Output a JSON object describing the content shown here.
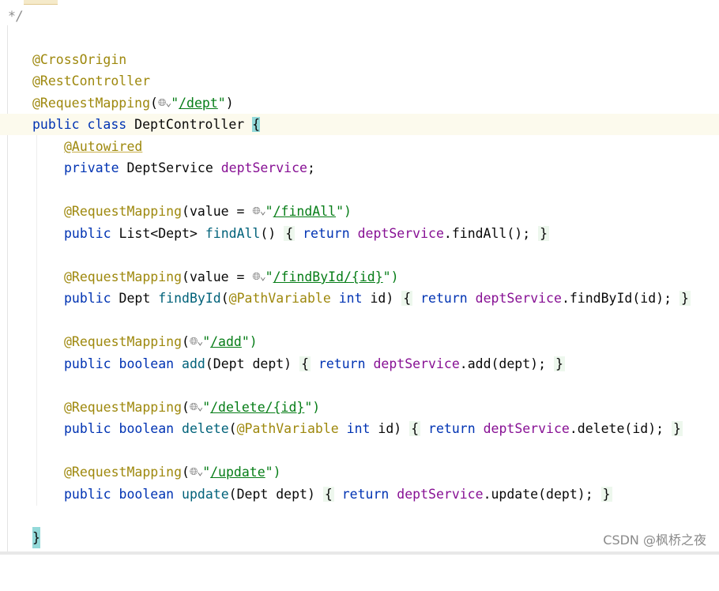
{
  "editor": {
    "comment_end": "*/",
    "lines": {
      "l_cross": "@CrossOrigin",
      "l_rest": "@RestController",
      "l_reqmap_ann": "@RequestMapping",
      "l_reqmap_open": "(",
      "l_reqmap_q1": "\"",
      "l_reqmap_url": "/dept",
      "l_reqmap_q2": "\"",
      "l_reqmap_close": ")",
      "l_class_public": "public",
      "l_class_kw": "class",
      "l_class_name": "DeptController",
      "l_class_brace": "{",
      "l_autowired": "@Autowired",
      "l_field_private": "private",
      "l_field_type": "DeptService",
      "l_field_name": "deptService",
      "l_field_semi": ";",
      "m1_ann": "@RequestMapping",
      "m1_args": "(value = ",
      "m1_q1": "\"",
      "m1_url": "/findAll",
      "m1_q2": "\")",
      "m1_public": "public",
      "m1_type": "List<Dept>",
      "m1_name": "findAll",
      "m1_params": "()",
      "m1_open": "{",
      "m1_return": "return",
      "m1_field": "deptService",
      "m1_call": ".findAll();",
      "m1_close": "}",
      "m2_ann": "@RequestMapping",
      "m2_args": "(value = ",
      "m2_q1": "\"",
      "m2_url": "/findById/{id}",
      "m2_q2": "\")",
      "m2_public": "public",
      "m2_type": "Dept",
      "m2_name": "findById",
      "m2_paren": "(",
      "m2_pathvar": "@PathVariable",
      "m2_int": "int",
      "m2_param": "id)",
      "m2_open": "{",
      "m2_return": "return",
      "m2_field": "deptService",
      "m2_call": ".findById(id);",
      "m2_close": "}",
      "m3_ann": "@RequestMapping",
      "m3_open_paren": "(",
      "m3_q1": "\"",
      "m3_url": "/add",
      "m3_q2": "\")",
      "m3_public": "public",
      "m3_type": "boolean",
      "m3_name": "add",
      "m3_params": "(Dept dept)",
      "m3_open": "{",
      "m3_return": "return",
      "m3_field": "deptService",
      "m3_call": ".add(dept);",
      "m3_close": "}",
      "m4_ann": "@RequestMapping",
      "m4_open_paren": "(",
      "m4_q1": "\"",
      "m4_url": "/delete/{id}",
      "m4_q2": "\")",
      "m4_public": "public",
      "m4_type": "boolean",
      "m4_name": "delete",
      "m4_paren": "(",
      "m4_pathvar": "@PathVariable",
      "m4_int": "int",
      "m4_param": "id)",
      "m4_open": "{",
      "m4_return": "return",
      "m4_field": "deptService",
      "m4_call": ".delete(id);",
      "m4_close": "}",
      "m5_ann": "@RequestMapping",
      "m5_open_paren": "(",
      "m5_q1": "\"",
      "m5_url": "/update",
      "m5_q2": "\")",
      "m5_public": "public",
      "m5_type": "boolean",
      "m5_name": "update",
      "m5_params": "(Dept dept)",
      "m5_open": "{",
      "m5_return": "return",
      "m5_field": "deptService",
      "m5_call": ".update(dept);",
      "m5_close": "}",
      "l_class_end": "}"
    },
    "globe_glyph": "🌐︎⌄"
  },
  "watermark": "CSDN @枫桥之夜",
  "colors": {
    "keyword": "#0033b3",
    "annotation": "#9e880d",
    "string": "#067d17",
    "field": "#871094",
    "method": "#00627a",
    "brace_highlight": "#93d9d9",
    "current_line": "#fcfaed"
  }
}
